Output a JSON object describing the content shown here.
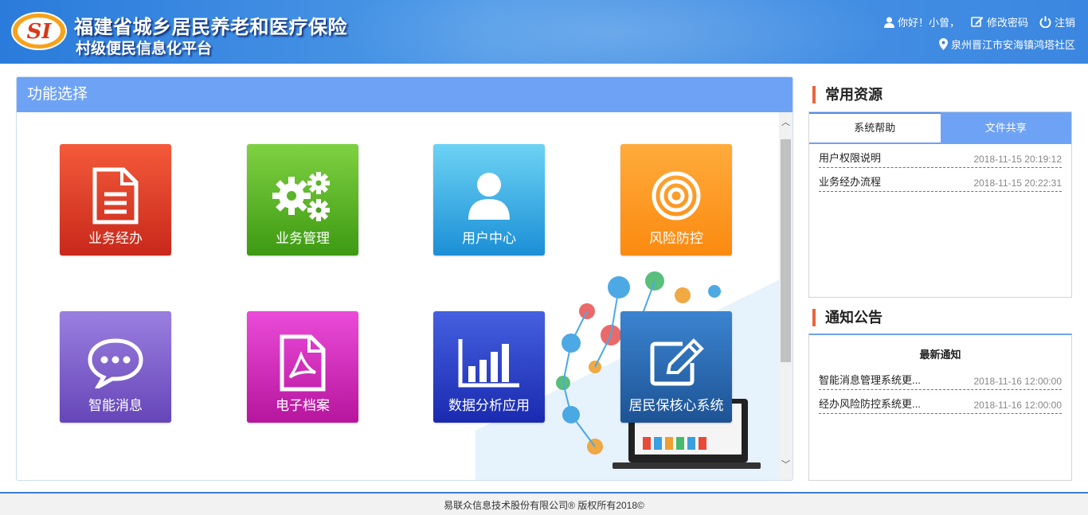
{
  "header": {
    "logo_text": "SI",
    "title": "福建省城乡居民养老和医疗保险",
    "subtitle": "村级便民信息化平台",
    "greeting": "你好！小曾，",
    "change_password": "修改密码",
    "logout": "注销",
    "location": "泉州晋江市安海镇鸿塔社区"
  },
  "functions": {
    "title": "功能选择",
    "tiles": [
      {
        "label": "业务经办",
        "icon": "document-icon"
      },
      {
        "label": "业务管理",
        "icon": "gears-icon"
      },
      {
        "label": "用户中心",
        "icon": "user-icon"
      },
      {
        "label": "风险防控",
        "icon": "target-icon"
      },
      {
        "label": "智能消息",
        "icon": "chat-icon"
      },
      {
        "label": "电子档案",
        "icon": "pdf-icon"
      },
      {
        "label": "数据分析应用",
        "icon": "bar-chart-icon"
      },
      {
        "label": "居民保核心系统",
        "icon": "edit-icon"
      }
    ]
  },
  "resources": {
    "title": "常用资源",
    "tabs": [
      {
        "label": "系统帮助",
        "active": true
      },
      {
        "label": "文件共享",
        "active": false
      }
    ],
    "items": [
      {
        "name": "用户权限说明",
        "date": "2018-11-15 20:19:12"
      },
      {
        "name": "业务经办流程",
        "date": "2018-11-15 20:22:31"
      }
    ]
  },
  "notices": {
    "title": "通知公告",
    "heading": "最新通知",
    "items": [
      {
        "name": "智能消息管理系统更...",
        "date": "2018-11-16 12:00:00"
      },
      {
        "name": "经办风险防控系统更...",
        "date": "2018-11-16 12:00:00"
      }
    ]
  },
  "footer": {
    "copyright": "易联众信息技术股份有限公司® 版权所有2018©"
  },
  "colors": {
    "header_blue": "#3b86e0",
    "panel_head_blue": "#6ea2f5",
    "accent_orange": "#e8663d"
  }
}
